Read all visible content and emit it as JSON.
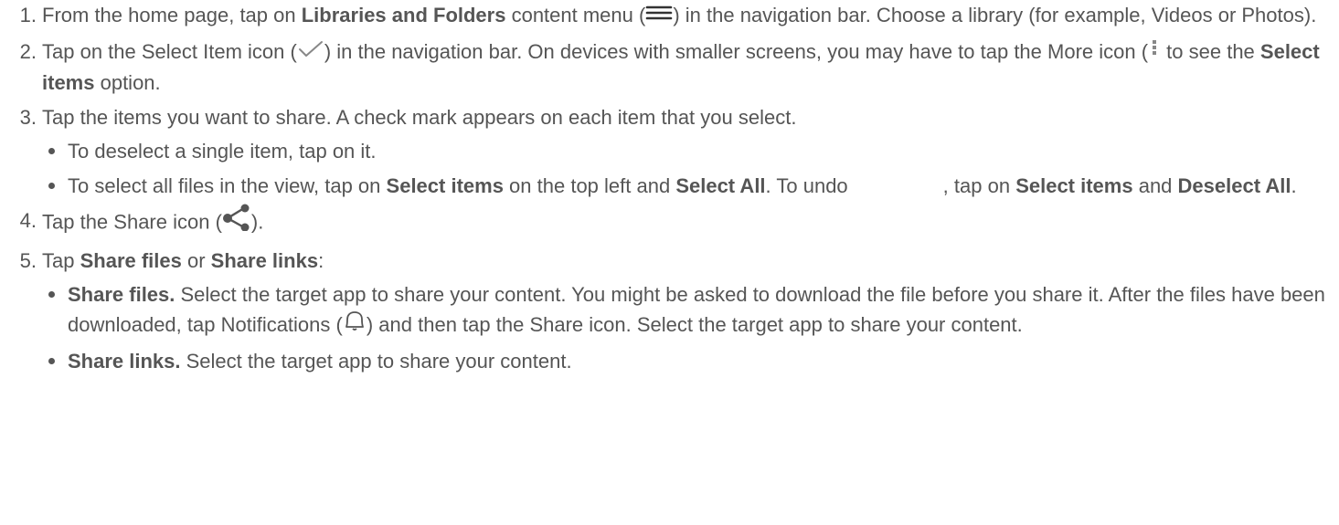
{
  "steps": [
    {
      "num": "1.",
      "t0": "From the home page, tap on ",
      "b0": "Libraries and Folders",
      "t1": " content menu (",
      "t2": ") in the navigation bar. Choose a library (for example, Videos or Photos).",
      "icon": "menu-icon"
    },
    {
      "num": "2.",
      "t0": "Tap on the Select Item icon (",
      "t1": ") in the navigation bar. On devices with smaller screens, you may have to tap the More icon (",
      "t2": " to see the ",
      "b0": "Select items",
      "t3": " option.",
      "icon": "checkmark-icon",
      "icon2": "more-vertical-icon"
    },
    {
      "num": "3.",
      "t0": "Tap the items you want to share. A check mark appears on each item that you select.",
      "bullets": [
        {
          "t0": "To deselect a single item, tap on it."
        },
        {
          "t0": "To select all files in the view, tap on ",
          "b0": "Select items",
          "t1": " on the top left and ",
          "b1": "Select All",
          "t2": ". To undo",
          "t3": ", tap on ",
          "b2": "Select items",
          "t4": " and ",
          "b3": "Deselect All",
          "t5": "."
        }
      ]
    },
    {
      "num": "4.",
      "t0": "Tap the Share icon (",
      "t1": ").",
      "icon": "share-icon"
    },
    {
      "num": "5.",
      "t0": "Tap ",
      "b0": "Share files",
      "t1": " or ",
      "b1": "Share links",
      "t2": ":",
      "bullets": [
        {
          "b0": "Share files.",
          "t0": " Select the target app to share your content. You might be asked to download the file before you share it. After the files have been downloaded, tap Notifications (",
          "t1": ") and then tap the Share icon. Select the target app to share your content.",
          "icon": "bell-icon"
        },
        {
          "b0": "Share links.",
          "t0": " Select the target app to share your content."
        }
      ]
    }
  ],
  "colors": {
    "text": "#555555",
    "icon": "#555555"
  }
}
